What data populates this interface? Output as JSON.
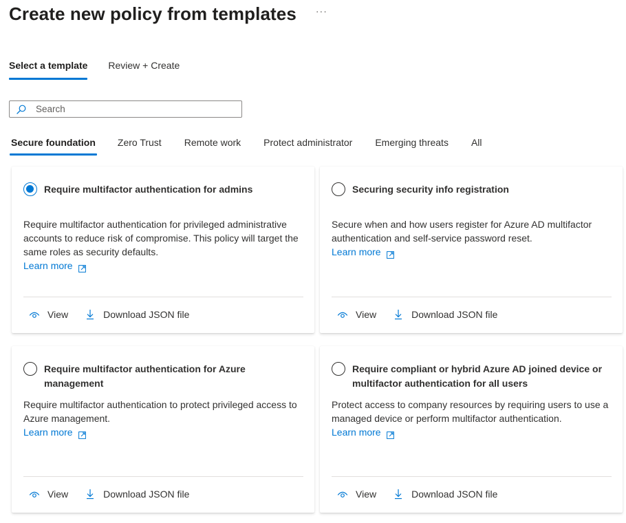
{
  "header": {
    "title": "Create new policy from templates",
    "more_label": "···"
  },
  "wizard_tabs": [
    {
      "label": "Select a template",
      "active": true
    },
    {
      "label": "Review + Create",
      "active": false
    }
  ],
  "search": {
    "icon": "search-icon",
    "placeholder": "Search",
    "value": ""
  },
  "category_tabs": [
    {
      "label": "Secure foundation",
      "active": true
    },
    {
      "label": "Zero Trust",
      "active": false
    },
    {
      "label": "Remote work",
      "active": false
    },
    {
      "label": "Protect administrator",
      "active": false
    },
    {
      "label": "Emerging threats",
      "active": false
    },
    {
      "label": "All",
      "active": false
    }
  ],
  "templates": [
    {
      "title": "Require multifactor authentication for admins",
      "selected": true,
      "description": "Require multifactor authentication for privileged administrative accounts to reduce risk of compromise. This policy will target the same roles as security defaults.",
      "learn_more": "Learn more",
      "view_label": "View",
      "download_label": "Download JSON file"
    },
    {
      "title": "Securing security info registration",
      "selected": false,
      "description": "Secure when and how users register for Azure AD multifactor authentication and self-service password reset.",
      "learn_more": "Learn more",
      "view_label": "View",
      "download_label": "Download JSON file"
    },
    {
      "title": "Require multifactor authentication for Azure management",
      "selected": false,
      "description": "Require multifactor authentication to protect privileged access to Azure management.",
      "learn_more": "Learn more",
      "view_label": "View",
      "download_label": "Download JSON file"
    },
    {
      "title": "Require compliant or hybrid Azure AD joined device or multifactor authentication for all users",
      "selected": false,
      "description": "Protect access to company resources by requiring users to use a managed device or perform multifactor authentication.",
      "learn_more": "Learn more",
      "view_label": "View",
      "download_label": "Download JSON file"
    }
  ],
  "colors": {
    "accent": "#0078d4",
    "text": "#323130",
    "divider": "#e1dfdd"
  }
}
